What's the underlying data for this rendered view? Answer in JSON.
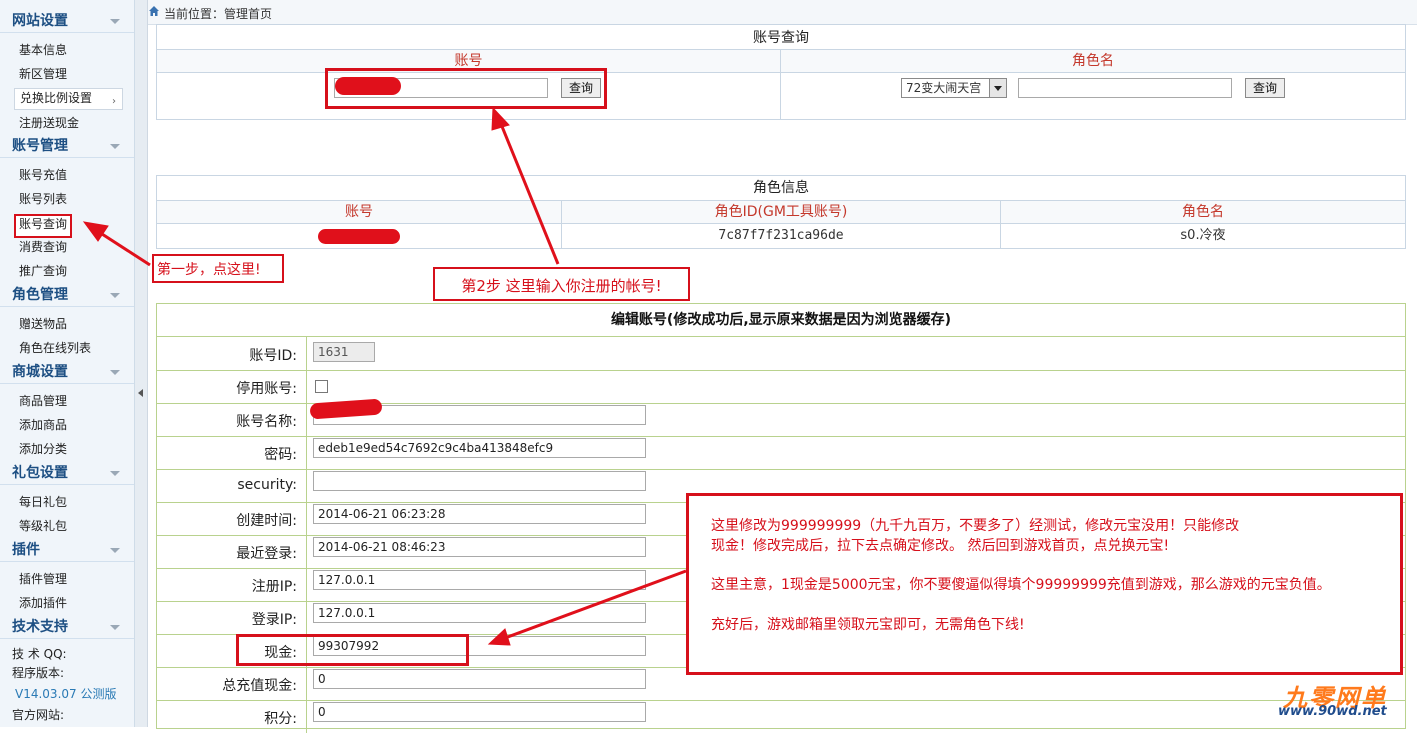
{
  "breadcrumb": {
    "text": "当前位置：管理首页"
  },
  "sidebar": {
    "groups": [
      {
        "title": "网站设置",
        "items": [
          "基本信息",
          "新区管理",
          "兑换比例设置",
          "注册送现金"
        ]
      },
      {
        "title": "账号管理",
        "items": [
          "账号充值",
          "账号列表",
          "账号查询",
          "消费查询",
          "推广查询"
        ]
      },
      {
        "title": "角色管理",
        "items": [
          "赠送物品",
          "角色在线列表"
        ]
      },
      {
        "title": "商城设置",
        "items": [
          "商品管理",
          "添加商品",
          "添加分类"
        ]
      },
      {
        "title": "礼包设置",
        "items": [
          "每日礼包",
          "等级礼包"
        ]
      },
      {
        "title": "插件",
        "items": [
          "插件管理",
          "添加插件"
        ]
      },
      {
        "title": "技术支持",
        "items": []
      }
    ],
    "support": {
      "qq": "技 术 QQ:",
      "version_label": "程序版本:",
      "version": "V14.03.07 公测版",
      "site": "官方网站:"
    }
  },
  "account_query": {
    "title": "账号查询",
    "col_account": "账号",
    "col_role": "角色名",
    "query_btn": "查询",
    "server_select": "72变大闹天宫",
    "account_value": "",
    "role_value": ""
  },
  "role_info": {
    "title": "角色信息",
    "headers": [
      "账号",
      "角色ID(GM工具账号)",
      "角色名"
    ],
    "row": {
      "role_id": "7c87f7f231ca96de",
      "role_name": "s0.冷夜"
    }
  },
  "edit_account": {
    "title": "编辑账号(修改成功后,显示原来数据是因为浏览器缓存)",
    "fields": [
      {
        "label": "账号ID:",
        "value": "1631"
      },
      {
        "label": "停用账号:",
        "value": ""
      },
      {
        "label": "账号名称:",
        "value": ""
      },
      {
        "label": "密码:",
        "value": "edeb1e9ed54c7692c9c4ba413848efc9"
      },
      {
        "label": "security:",
        "value": ""
      },
      {
        "label": "创建时间:",
        "value": "2014-06-21 06:23:28"
      },
      {
        "label": "最近登录:",
        "value": "2014-06-21 08:46:23"
      },
      {
        "label": "注册IP:",
        "value": "127.0.0.1"
      },
      {
        "label": "登录IP:",
        "value": "127.0.0.1"
      },
      {
        "label": "现金:",
        "value": "99307992"
      },
      {
        "label": "总充值现金:",
        "value": "0"
      },
      {
        "label": "积分:",
        "value": "0"
      }
    ]
  },
  "annotations": {
    "step1": "第一步，点这里!",
    "step2": "第2步  这里输入你注册的帐号!",
    "note_lines": [
      "这里修改为999999999（九千九百万，不要多了）经测试，修改元宝没用！只能修改",
      "现金！修改完成后，拉下去点确定修改。 然后回到游戏首页，点兑换元宝!",
      "这里主意，1现金是5000元宝，你不要傻逼似得填个99999999充值到游戏，那么游戏的元宝负值。",
      "充好后，游戏邮箱里领取元宝即可，无需角色下线!"
    ],
    "color": "#d6101b"
  },
  "watermark": {
    "logo": "九零网单",
    "url": "www.90wd.net"
  }
}
